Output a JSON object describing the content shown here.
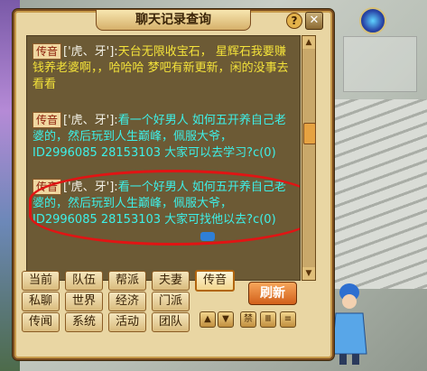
{
  "window": {
    "title": "聊天记录查询",
    "help": "?",
    "close": "✕"
  },
  "messages": [
    {
      "tag": "传音",
      "sender": "['虎、牙']:",
      "text": "天台无限收宝石，  星辉石我要赚钱养老婆啊，，哈哈哈 梦吧有新更新，闲的没事去看看",
      "color": "yellow"
    },
    {
      "tag": "传音",
      "sender": "['虎、牙']:",
      "text": "看一个好男人 如何五开养自己老婆的，然后玩到人生巅峰，佩服大爷，ID2996085 28153103 大家可以去学习?c(0)",
      "color": "cyan"
    },
    {
      "tag": "传音",
      "sender": "['虎、牙']:",
      "text": "看一个好男人 如何五开养自己老婆的，然后玩到人生巅峰，佩服大爷，ID2996085 28153103 大家可找他以去?c(0)",
      "color": "cyan"
    }
  ],
  "channels": {
    "row1": [
      "当前",
      "队伍",
      "帮派",
      "夫妻",
      "传音"
    ],
    "row2": [
      "私聊",
      "世界",
      "经济",
      "门派"
    ],
    "row3": [
      "传闻",
      "系统",
      "活动",
      "团队"
    ]
  },
  "active_channel": "传音",
  "refresh_label": "刷新",
  "tools": {
    "up": "▲",
    "down": "▼",
    "ban": "禁",
    "grid": "Ⅲ",
    "lines": "≡"
  },
  "scroll": {
    "up": "▲",
    "down": "▼"
  }
}
